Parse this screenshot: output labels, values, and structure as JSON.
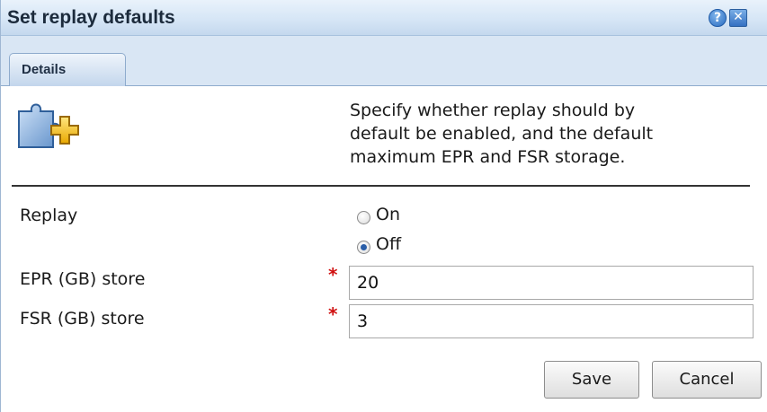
{
  "dialog": {
    "title": "Set replay defaults",
    "help_icon": "?",
    "close_icon": "✕"
  },
  "tabs": [
    {
      "label": "Details",
      "selected": true
    }
  ],
  "description": {
    "line1": "Specify whether replay should by",
    "line2": "default be enabled, and the default",
    "line3": "maximum EPR and FSR storage."
  },
  "form": {
    "replay_label": "Replay",
    "replay_options": [
      {
        "label": "On",
        "checked": false
      },
      {
        "label": "Off",
        "checked": true
      }
    ],
    "epr_label": "EPR (GB) store",
    "epr_value": "20",
    "fsr_label": "FSR (GB) store",
    "fsr_value": "3",
    "required_marker": "*"
  },
  "buttons": {
    "save": "Save",
    "cancel": "Cancel"
  },
  "icons": {
    "main": "puzzle-add-icon",
    "help": "help-icon",
    "close": "close-icon"
  },
  "colors": {
    "title_bar": "#d6e6f6",
    "tab_strip": "#d9e6f4",
    "required": "#d01010",
    "radio_selected": "#2a5ea8"
  }
}
